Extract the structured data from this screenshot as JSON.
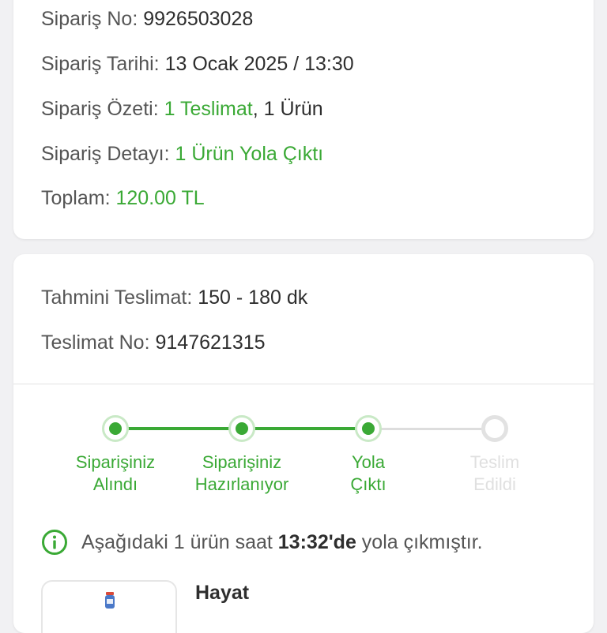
{
  "order": {
    "number_label": "Sipariş No:",
    "number_value": "9926503028",
    "date_label": "Sipariş Tarihi:",
    "date_value": "13 Ocak 2025 / 13:30",
    "summary_label": "Sipariş Özeti:",
    "summary_deliveries": "1 Teslimat",
    "summary_items": ", 1 Ürün",
    "detail_label": "Sipariş Detayı:",
    "detail_value": "1 Ürün Yola Çıktı",
    "total_label": "Toplam:",
    "total_value": "120.00 TL"
  },
  "delivery": {
    "estimate_label": "Tahmini Teslimat:",
    "estimate_value": "150 - 180 dk",
    "number_label": "Teslimat No:",
    "number_value": "9147621315",
    "steps": [
      {
        "label": "Siparişiniz\nAlındı",
        "state": "done"
      },
      {
        "label": "Siparişiniz\nHazırlanıyor",
        "state": "done"
      },
      {
        "label": "Yola\nÇıktı",
        "state": "done"
      },
      {
        "label": "Teslim\nEdildi",
        "state": "todo"
      }
    ],
    "info_prefix": "Aşağıdaki 1 ürün saat",
    "info_time": "13:32'de",
    "info_suffix": "yola çıkmıştır.",
    "info_icon": "info-circle-icon",
    "product_name": "Hayat"
  },
  "colors": {
    "accent": "#3aa935",
    "accent_light": "#c9e9c6",
    "inactive": "#e0e0e0",
    "background": "#f1f1f3"
  }
}
